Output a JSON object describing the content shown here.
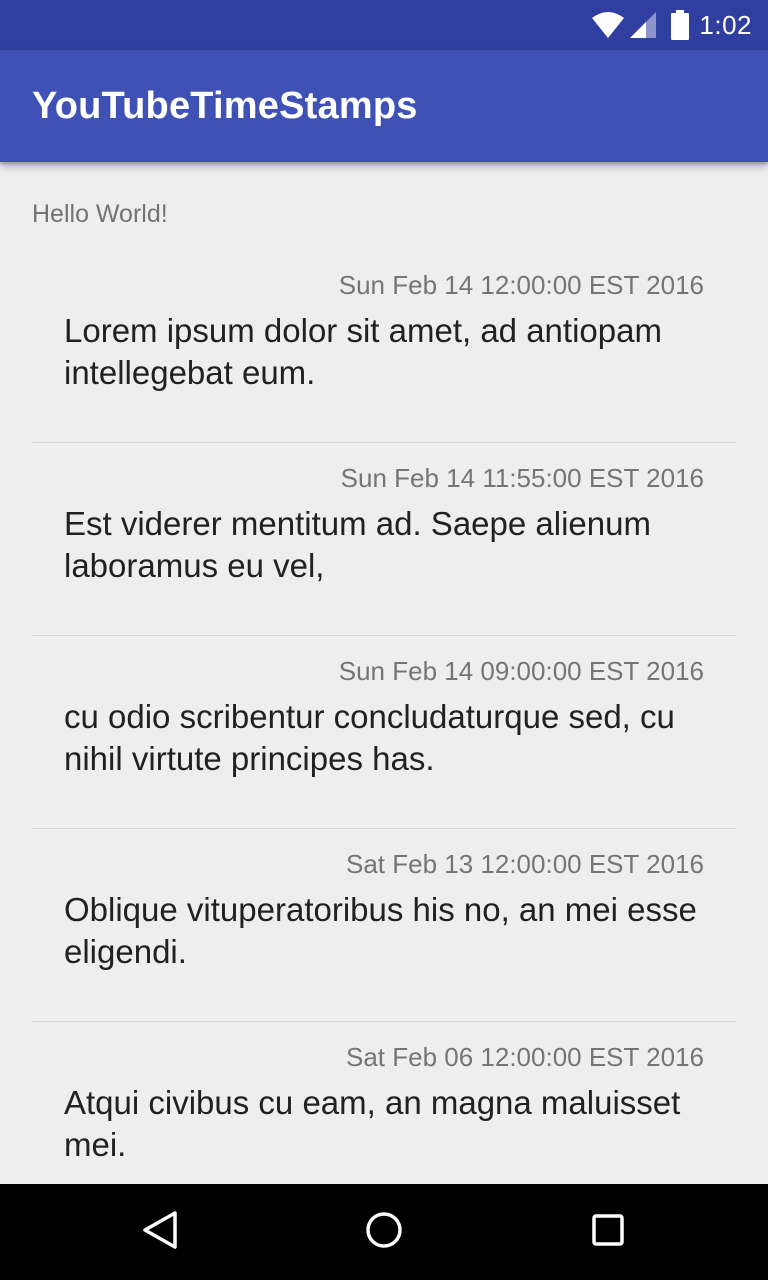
{
  "status_bar": {
    "time": "1:02",
    "icons": [
      "wifi-icon",
      "cellular-signal-icon",
      "battery-icon"
    ]
  },
  "app_bar": {
    "title": "YouTubeTimeStamps"
  },
  "main": {
    "hello_text": "Hello World!",
    "items": [
      {
        "timestamp": "Sun Feb 14 12:00:00 EST 2016",
        "comment": "Lorem ipsum dolor sit amet, ad antiopam intellegebat eum."
      },
      {
        "timestamp": "Sun Feb 14 11:55:00 EST 2016",
        "comment": "Est viderer mentitum ad. Saepe alienum laboramus eu vel,"
      },
      {
        "timestamp": "Sun Feb 14 09:00:00 EST 2016",
        "comment": "cu odio scribentur concludaturque sed, cu nihil virtute principes has."
      },
      {
        "timestamp": "Sat Feb 13 12:00:00 EST 2016",
        "comment": "Oblique vituperatoribus his no, an mei esse eligendi."
      },
      {
        "timestamp": "Sat Feb 06 12:00:00 EST 2016",
        "comment": "Atqui civibus cu eam, an magna maluisset mei."
      }
    ]
  },
  "nav_bar": {
    "icons": [
      "back-icon",
      "home-icon",
      "recents-icon"
    ]
  },
  "colors": {
    "status_bar": "#303f9f",
    "app_bar": "#3f51b5",
    "background": "#eeeeee",
    "timestamp_text": "#757575",
    "comment_text": "#212121"
  }
}
